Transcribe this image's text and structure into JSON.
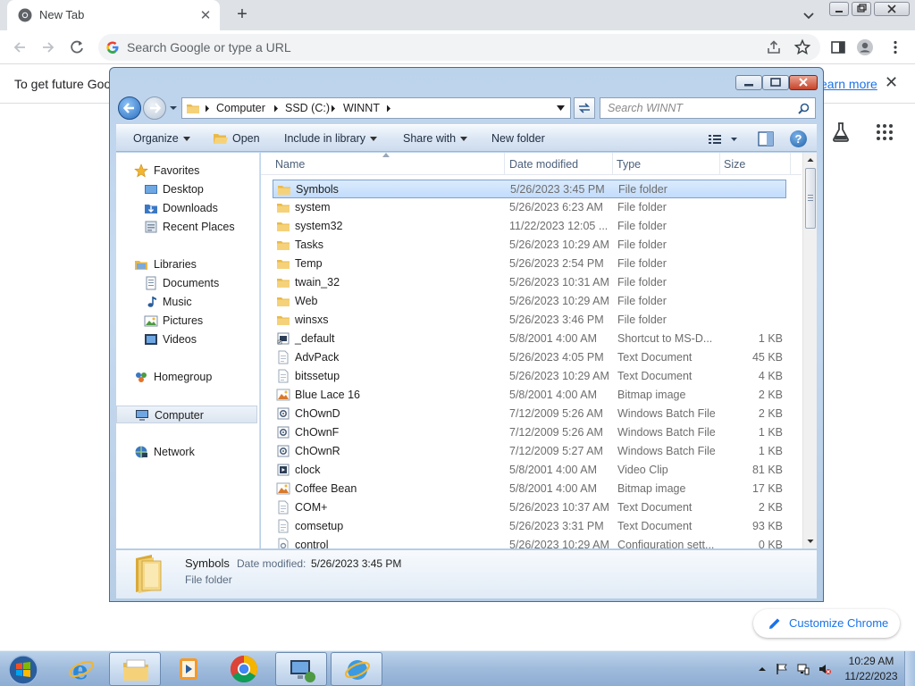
{
  "browser": {
    "tab_title": "New Tab",
    "omnibox_placeholder": "Search Google or type a URL",
    "infobar_text": "To get future Goog",
    "infobar_link": "earn more",
    "customize_label": "Customize Chrome"
  },
  "explorer": {
    "breadcrumbs": [
      "Computer",
      "SSD (C:)",
      "WINNT"
    ],
    "search_placeholder": "Search WINNT",
    "commands": {
      "organize": "Organize",
      "open": "Open",
      "include": "Include in library",
      "share": "Share with",
      "new_folder": "New folder"
    },
    "nav": {
      "favorites": "Favorites",
      "desktop": "Desktop",
      "downloads": "Downloads",
      "recent": "Recent Places",
      "libraries": "Libraries",
      "documents": "Documents",
      "music": "Music",
      "pictures": "Pictures",
      "videos": "Videos",
      "homegroup": "Homegroup",
      "computer": "Computer",
      "network": "Network"
    },
    "columns": {
      "name": "Name",
      "date": "Date modified",
      "type": "Type",
      "size": "Size"
    },
    "files": [
      {
        "name": "Symbols",
        "date": "5/26/2023 3:45 PM",
        "type": "File folder",
        "size": "",
        "icon": "folder-icon",
        "selected": true
      },
      {
        "name": "system",
        "date": "5/26/2023 6:23 AM",
        "type": "File folder",
        "size": "",
        "icon": "folder-icon"
      },
      {
        "name": "system32",
        "date": "11/22/2023 12:05 ...",
        "type": "File folder",
        "size": "",
        "icon": "folder-icon"
      },
      {
        "name": "Tasks",
        "date": "5/26/2023 10:29 AM",
        "type": "File folder",
        "size": "",
        "icon": "folder-icon"
      },
      {
        "name": "Temp",
        "date": "5/26/2023 2:54 PM",
        "type": "File folder",
        "size": "",
        "icon": "folder-icon"
      },
      {
        "name": "twain_32",
        "date": "5/26/2023 10:31 AM",
        "type": "File folder",
        "size": "",
        "icon": "folder-icon"
      },
      {
        "name": "Web",
        "date": "5/26/2023 10:29 AM",
        "type": "File folder",
        "size": "",
        "icon": "folder-icon"
      },
      {
        "name": "winsxs",
        "date": "5/26/2023 3:46 PM",
        "type": "File folder",
        "size": "",
        "icon": "folder-icon"
      },
      {
        "name": "_default",
        "date": "5/8/2001 4:00 AM",
        "type": "Shortcut to MS-D...",
        "size": "1 KB",
        "icon": "shortcut-icon"
      },
      {
        "name": "AdvPack",
        "date": "5/26/2023 4:05 PM",
        "type": "Text Document",
        "size": "45 KB",
        "icon": "text-doc-icon"
      },
      {
        "name": "bitssetup",
        "date": "5/26/2023 10:29 AM",
        "type": "Text Document",
        "size": "4 KB",
        "icon": "text-doc-icon"
      },
      {
        "name": "Blue Lace 16",
        "date": "5/8/2001 4:00 AM",
        "type": "Bitmap image",
        "size": "2 KB",
        "icon": "bitmap-icon"
      },
      {
        "name": "ChOwnD",
        "date": "7/12/2009 5:26 AM",
        "type": "Windows Batch File",
        "size": "2 KB",
        "icon": "batch-file-icon"
      },
      {
        "name": "ChOwnF",
        "date": "7/12/2009 5:26 AM",
        "type": "Windows Batch File",
        "size": "1 KB",
        "icon": "batch-file-icon"
      },
      {
        "name": "ChOwnR",
        "date": "7/12/2009 5:27 AM",
        "type": "Windows Batch File",
        "size": "1 KB",
        "icon": "batch-file-icon"
      },
      {
        "name": "clock",
        "date": "5/8/2001 4:00 AM",
        "type": "Video Clip",
        "size": "81 KB",
        "icon": "video-clip-icon"
      },
      {
        "name": "Coffee Bean",
        "date": "5/8/2001 4:00 AM",
        "type": "Bitmap image",
        "size": "17 KB",
        "icon": "bitmap-icon"
      },
      {
        "name": "COM+",
        "date": "5/26/2023 10:37 AM",
        "type": "Text Document",
        "size": "2 KB",
        "icon": "text-doc-icon"
      },
      {
        "name": "comsetup",
        "date": "5/26/2023 3:31 PM",
        "type": "Text Document",
        "size": "93 KB",
        "icon": "text-doc-icon"
      },
      {
        "name": "control",
        "date": "5/26/2023 10:29 AM",
        "type": "Configuration sett...",
        "size": "0 KB",
        "icon": "config-file-icon"
      }
    ],
    "details": {
      "name": "Symbols",
      "modified_label": "Date modified:",
      "modified_value": "5/26/2023 3:45 PM",
      "type": "File folder"
    }
  },
  "taskbar": {
    "time": "10:29 AM",
    "date": "11/22/2023"
  }
}
